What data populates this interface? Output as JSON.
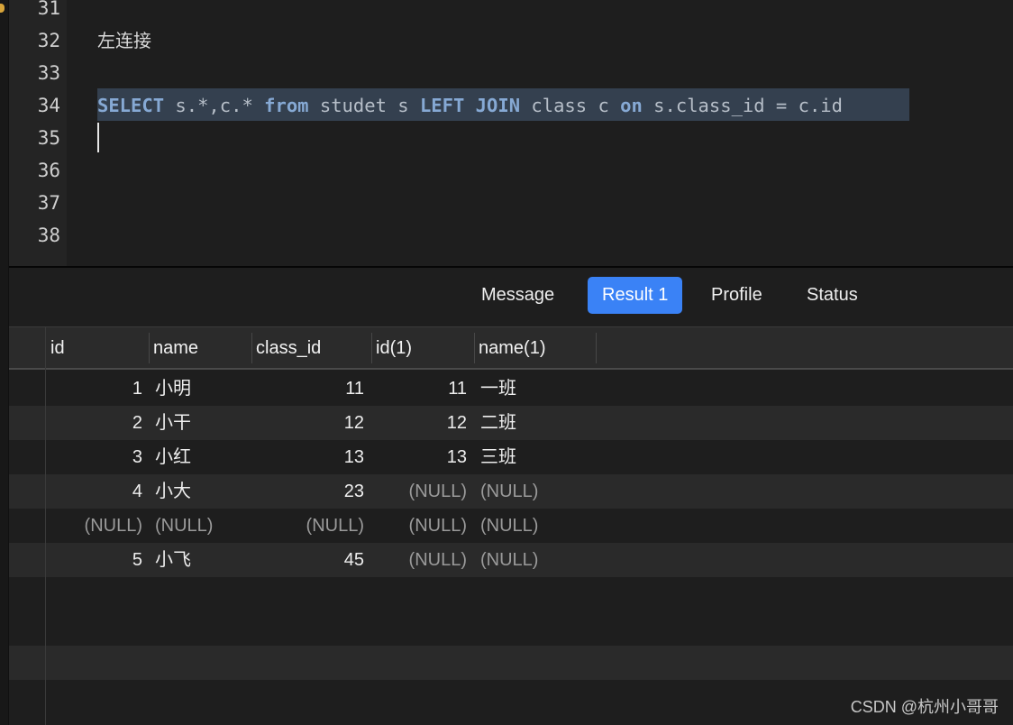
{
  "editor": {
    "line_numbers": [
      "31",
      "32",
      "33",
      "34",
      "35",
      "36",
      "37",
      "38"
    ],
    "comment": "左连接",
    "sql_tokens": [
      {
        "t": "SELECT",
        "k": true
      },
      {
        "t": " s.*,c.* ",
        "k": false
      },
      {
        "t": "from",
        "k": true
      },
      {
        "t": " studet s ",
        "k": false
      },
      {
        "t": "LEFT JOIN",
        "k": true
      },
      {
        "t": " class c ",
        "k": false
      },
      {
        "t": "on",
        "k": true
      },
      {
        "t": " s.class_id = c.id",
        "k": false
      }
    ]
  },
  "tabs": [
    "Message",
    "Result 1",
    "Profile",
    "Status"
  ],
  "active_tab": "Result 1",
  "result": {
    "columns": [
      "id",
      "name",
      "class_id",
      "id(1)",
      "name(1)"
    ],
    "rows": [
      [
        "1",
        "小明",
        "11",
        "11",
        "一班"
      ],
      [
        "2",
        "小干",
        "12",
        "12",
        "二班"
      ],
      [
        "3",
        "小红",
        "13",
        "13",
        "三班"
      ],
      [
        "4",
        "小大",
        "23",
        "(NULL)",
        "(NULL)"
      ],
      [
        "(NULL)",
        "(NULL)",
        "(NULL)",
        "(NULL)",
        "(NULL)"
      ],
      [
        "5",
        "小飞",
        "45",
        "(NULL)",
        "(NULL)"
      ]
    ]
  },
  "watermark": "CSDN @杭州小哥哥",
  "colors": {
    "accent": "#3a82f6",
    "keyword": "#86a9d4",
    "selection": "#34404f"
  }
}
